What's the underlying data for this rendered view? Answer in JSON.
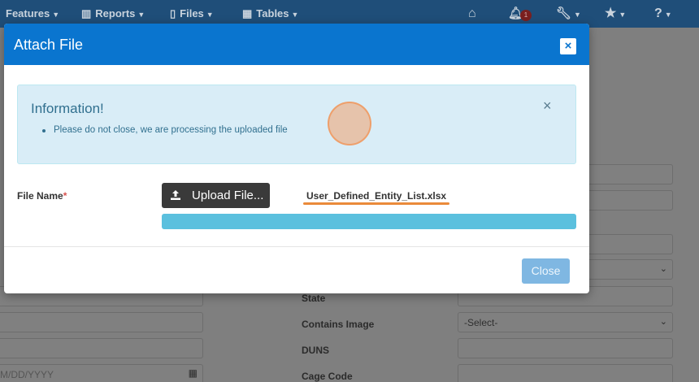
{
  "navbar": {
    "items": [
      {
        "label": "Features",
        "icon": "none"
      },
      {
        "label": "Reports",
        "icon": "bar-chart-icon"
      },
      {
        "label": "Files",
        "icon": "file-icon"
      },
      {
        "label": "Tables",
        "icon": "table-icon"
      }
    ],
    "notification_count": "1",
    "icons": [
      "home-icon",
      "bell-icon",
      "wrench-icon",
      "star-icon",
      "help-icon"
    ]
  },
  "background_form": {
    "labels": [
      "State",
      "Contains Image",
      "DUNS",
      "Cage Code"
    ],
    "contains_image_value": "-Select-",
    "date_placeholder": "M/DD/YYYY"
  },
  "modal": {
    "title": "Attach File",
    "close_symbol": "×",
    "alert": {
      "title": "Information!",
      "message": "Please do not close, we are processing the uploaded file",
      "close_symbol": "×"
    },
    "file_name_label": "File Name",
    "required_marker": "*",
    "upload_button_label": "Upload File...",
    "selected_file": "User_Defined_Entity_List.xlsx",
    "upload_progress": 1.0,
    "close_button_label": "Close"
  },
  "colors": {
    "header_blue": "#0a75cf",
    "alert_bg": "#d9edf7",
    "progress": "#5bc0de",
    "highlight": "#ea8a3a"
  }
}
